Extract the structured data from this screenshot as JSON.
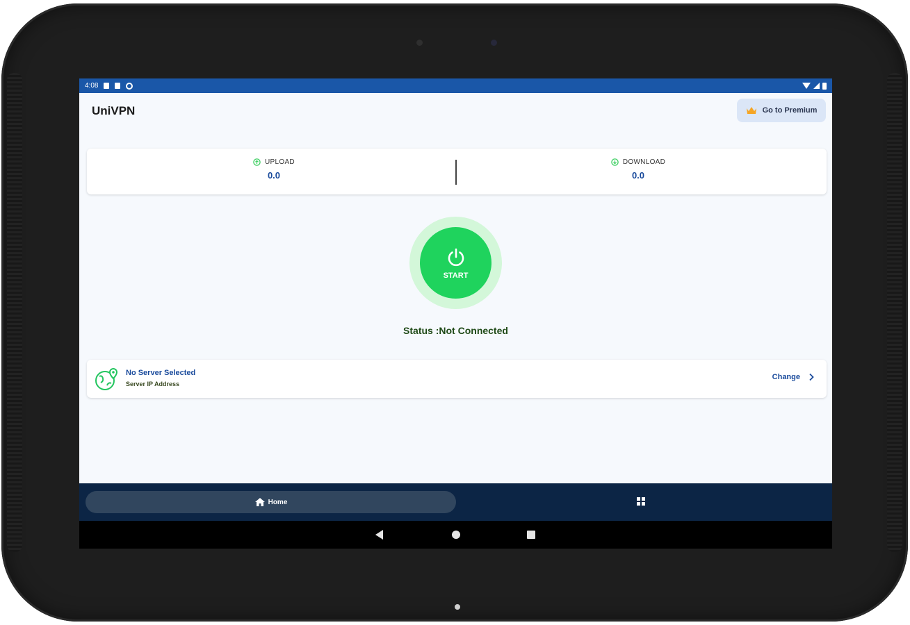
{
  "status_bar": {
    "time": "4:08"
  },
  "app": {
    "title": "UniVPN"
  },
  "premium": {
    "label": "Go to Premium",
    "icon": "crown-icon",
    "icon_color": "#f5a524"
  },
  "stats": {
    "upload": {
      "label": "UPLOAD",
      "value": "0.0"
    },
    "download": {
      "label": "DOWNLOAD",
      "value": "0.0"
    }
  },
  "power": {
    "label": "START",
    "icon": "power-icon"
  },
  "status": {
    "text": "Status :Not Connected"
  },
  "server": {
    "name": "No Server Selected",
    "ip": "Server IP Address",
    "change_label": "Change"
  },
  "bottom_nav": {
    "items": [
      {
        "label": "Home",
        "icon": "home-icon",
        "active": true
      },
      {
        "label": "",
        "icon": "grid-icon",
        "active": false
      }
    ]
  },
  "colors": {
    "status_bar": "#1a57a8",
    "accent_green": "#1fd35d",
    "accent_blue": "#1a4b9c",
    "nav_bg": "#0c2545"
  }
}
